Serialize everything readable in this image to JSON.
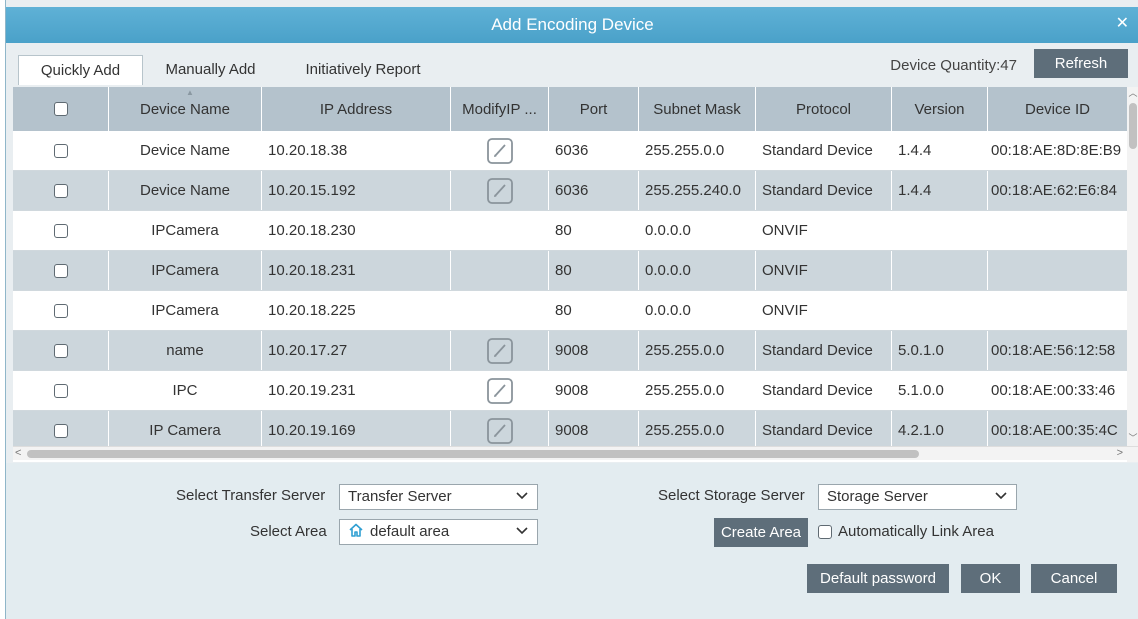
{
  "dialog": {
    "title": "Add Encoding Device",
    "close_glyph": "✕"
  },
  "tabs": [
    {
      "label": "Quickly Add",
      "active": true
    },
    {
      "label": "Manually Add",
      "active": false
    },
    {
      "label": "Initiatively Report",
      "active": false
    }
  ],
  "device_quantity": "Device Quantity:47",
  "refresh_label": "Refresh",
  "table": {
    "columns": [
      "Device Name",
      "IP Address",
      "ModifyIP ...",
      "Port",
      "Subnet Mask",
      "Protocol",
      "Version",
      "Device ID"
    ],
    "rows": [
      {
        "name": "Device Name",
        "ip": "10.20.18.38",
        "editable": true,
        "port": "6036",
        "mask": "255.255.0.0",
        "protocol": "Standard Device",
        "version": "1.4.4",
        "id": "00:18:AE:8D:8E:B9"
      },
      {
        "name": "Device Name",
        "ip": "10.20.15.192",
        "editable": true,
        "port": "6036",
        "mask": "255.255.240.0",
        "protocol": "Standard Device",
        "version": "1.4.4",
        "id": "00:18:AE:62:E6:84"
      },
      {
        "name": "IPCamera",
        "ip": "10.20.18.230",
        "editable": false,
        "port": "80",
        "mask": "0.0.0.0",
        "protocol": "ONVIF",
        "version": "",
        "id": ""
      },
      {
        "name": "IPCamera",
        "ip": "10.20.18.231",
        "editable": false,
        "port": "80",
        "mask": "0.0.0.0",
        "protocol": "ONVIF",
        "version": "",
        "id": ""
      },
      {
        "name": "IPCamera",
        "ip": "10.20.18.225",
        "editable": false,
        "port": "80",
        "mask": "0.0.0.0",
        "protocol": "ONVIF",
        "version": "",
        "id": ""
      },
      {
        "name": "name",
        "ip": "10.20.17.27",
        "editable": true,
        "port": "9008",
        "mask": "255.255.0.0",
        "protocol": "Standard Device",
        "version": "5.0.1.0",
        "id": "00:18:AE:56:12:58"
      },
      {
        "name": "IPC",
        "ip": "10.20.19.231",
        "editable": true,
        "port": "9008",
        "mask": "255.255.0.0",
        "protocol": "Standard Device",
        "version": "5.1.0.0",
        "id": "00:18:AE:00:33:46"
      },
      {
        "name": "IP Camera",
        "ip": "10.20.19.169",
        "editable": true,
        "port": "9008",
        "mask": "255.255.0.0",
        "protocol": "Standard Device",
        "version": "4.2.1.0",
        "id": "00:18:AE:00:35:4C"
      }
    ]
  },
  "bottom": {
    "transfer_label": "Select Transfer Server",
    "transfer_value": "Transfer Server",
    "storage_label": "Select Storage Server",
    "storage_value": "Storage Server",
    "area_label": "Select Area",
    "area_value": "default area",
    "create_area": "Create Area",
    "auto_link": "Automatically Link Area",
    "default_password": "Default password",
    "ok": "OK",
    "cancel": "Cancel"
  },
  "colors": {
    "titlebar": "#4aa1c9",
    "header": "#b4c2cc",
    "row_alt": "#ccd6dc",
    "button": "#5e6e7a"
  }
}
